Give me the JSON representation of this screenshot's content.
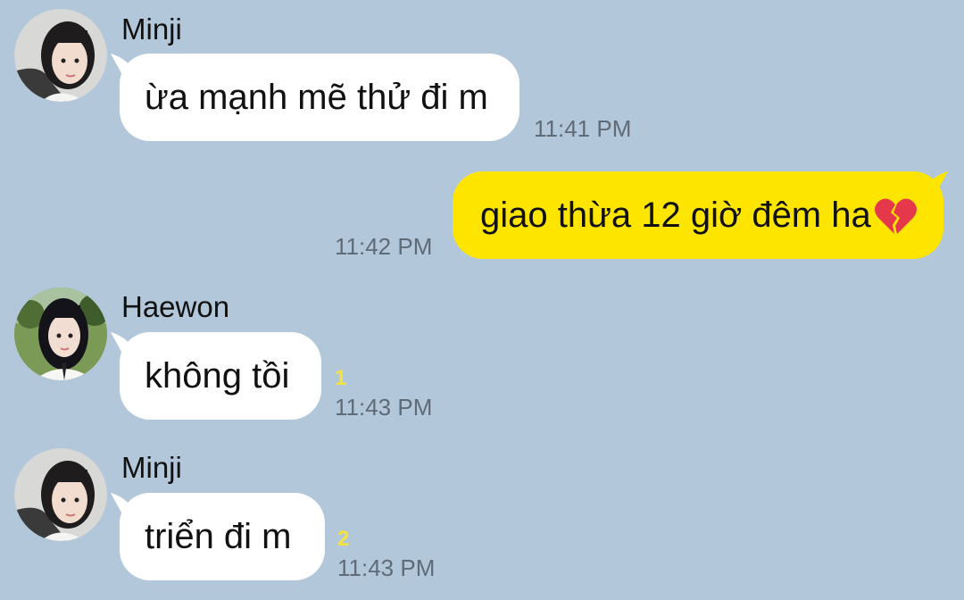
{
  "colors": {
    "background": "#b2c7da",
    "incoming_bubble": "#ffffff",
    "outgoing_bubble": "#fee500",
    "timestamp": "#5f6b77",
    "unread_count": "#f4e33c"
  },
  "messages": [
    {
      "direction": "incoming",
      "sender": "Minji",
      "text": "ừa mạnh mẽ thử đi m",
      "time": "11:41 PM",
      "avatar_icon": "profile-photo-icon"
    },
    {
      "direction": "outgoing",
      "text": "giao thừa 12 giờ đêm ha",
      "emoji": "broken-heart-icon",
      "time": "11:42 PM"
    },
    {
      "direction": "incoming",
      "sender": "Haewon",
      "text": "không tồi",
      "unread": "1",
      "time": "11:43 PM",
      "avatar_icon": "profile-photo-icon"
    },
    {
      "direction": "incoming",
      "sender": "Minji",
      "text": "triển đi m",
      "unread": "2",
      "time": "11:43 PM",
      "avatar_icon": "profile-photo-icon"
    }
  ]
}
